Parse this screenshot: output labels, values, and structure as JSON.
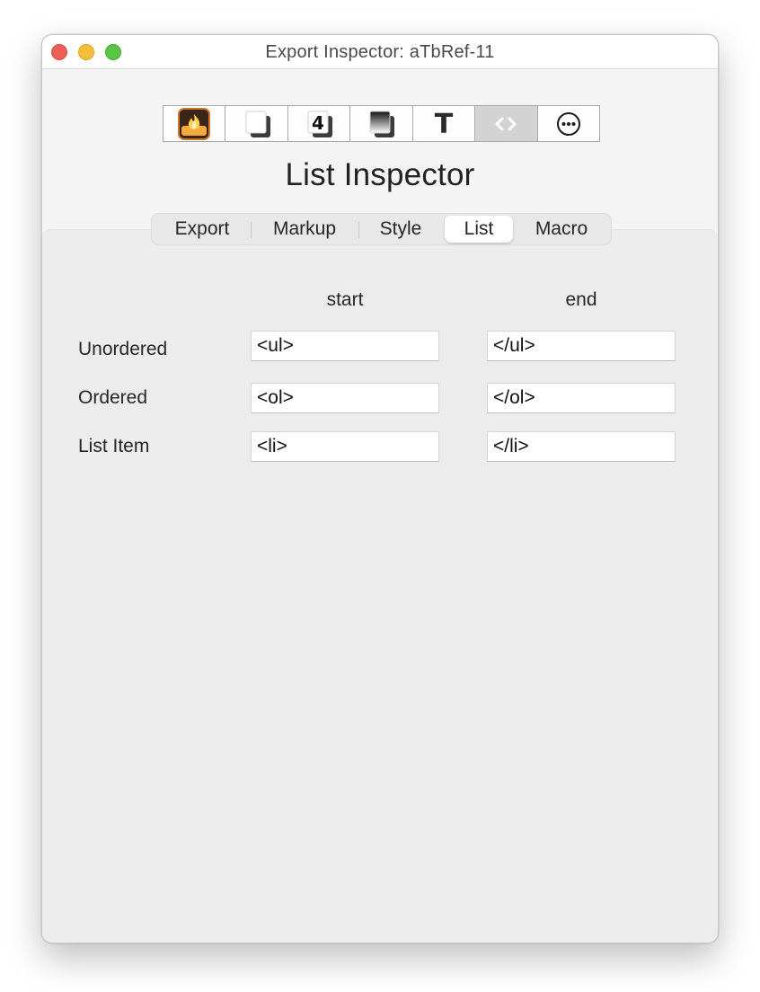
{
  "window": {
    "title": "Export Inspector: aTbRef-11"
  },
  "toolbar": {
    "buttons": [
      {
        "icon": "flame-icon",
        "selected": false
      },
      {
        "icon": "note-page-icon",
        "selected": false
      },
      {
        "icon": "number-4-icon",
        "selected": false
      },
      {
        "icon": "gradient-square-icon",
        "selected": false
      },
      {
        "icon": "text-t-icon",
        "selected": false
      },
      {
        "icon": "angle-brackets-icon",
        "selected": true
      },
      {
        "icon": "ellipsis-circle-icon",
        "selected": false
      }
    ]
  },
  "inspector": {
    "heading": "List Inspector"
  },
  "tabs": [
    {
      "label": "Export",
      "active": false
    },
    {
      "label": "Markup",
      "active": false
    },
    {
      "label": "Style",
      "active": false
    },
    {
      "label": "List",
      "active": true
    },
    {
      "label": "Macro",
      "active": false
    }
  ],
  "table": {
    "columns": {
      "start": "start",
      "end": "end"
    },
    "rows": [
      {
        "label": "Unordered",
        "start": "<ul>",
        "end": "</ul>"
      },
      {
        "label": "Ordered",
        "start": "<ol>",
        "end": "</ol>"
      },
      {
        "label": "List Item",
        "start": "<li>",
        "end": "</li>"
      }
    ]
  },
  "colors": {
    "close": "#ee5f57",
    "minimize": "#f6bd3b",
    "maximize": "#5ac444",
    "selected_toolbar": "#d3d3d3"
  }
}
